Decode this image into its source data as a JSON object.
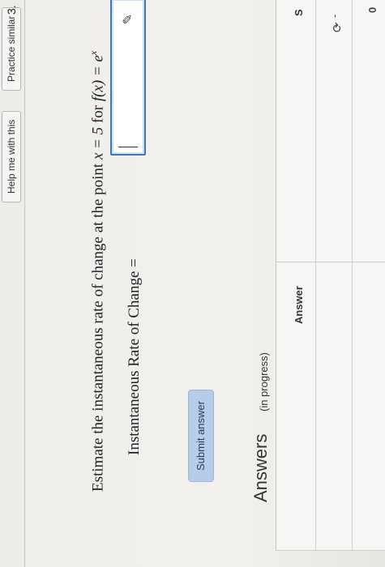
{
  "header": {
    "question_number": "3.",
    "buttons": [
      "Practice similar",
      "Help me with this"
    ]
  },
  "question": {
    "prompt_text": "Estimate the instantaneous rate of change at the point",
    "point_expr": "x = 5",
    "for_text": "for",
    "function_expr": "f(x) = e",
    "function_exp": "x"
  },
  "answer_field": {
    "label": "Instantaneous Rate of Change =",
    "value": ""
  },
  "submit_label": "Submit answer",
  "answers_section": {
    "title": "Answers",
    "status": "(in progress)",
    "column_header": "Answer",
    "right_header_partial": "S",
    "row1_marker": "-",
    "row2_value_partial": "0"
  }
}
